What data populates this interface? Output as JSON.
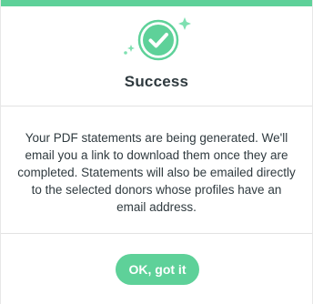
{
  "modal": {
    "accent_color": "#5ed199",
    "icon": "success-check-icon",
    "title": "Success",
    "message": "Your PDF statements are being generated. We'll email you a link to download them once they are completed. Statements will also be emailed directly to the selected donors whose profiles have an email address.",
    "ok_button_label": "OK, got it"
  }
}
